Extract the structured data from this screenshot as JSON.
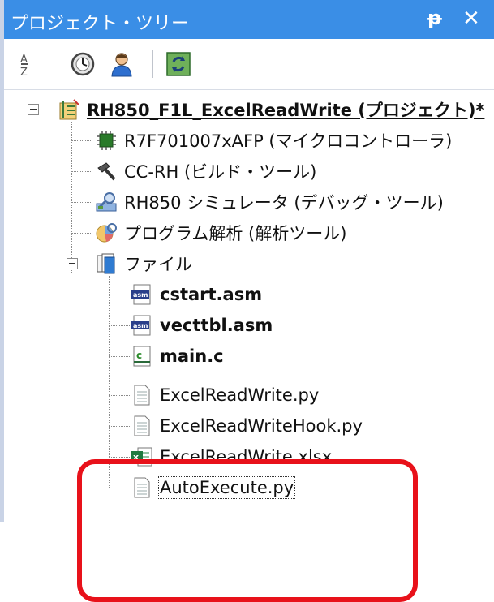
{
  "panel": {
    "title": "プロジェクト・ツリー",
    "pin_glyph": "ᵽ",
    "close_glyph": "✕",
    "toolbar": [
      {
        "name": "sort-icon",
        "glyph": "ア/Z"
      },
      {
        "name": "clock-icon"
      },
      {
        "name": "person-icon"
      },
      {
        "name": "refresh-icon"
      }
    ]
  },
  "tree": {
    "project": "RH850_F1L_ExcelReadWrite (プロジェクト)*",
    "nodes": [
      {
        "label": "R7F701007xAFP (マイクロコントローラ)",
        "icon": "chip-icon"
      },
      {
        "label": "CC-RH (ビルド・ツール)",
        "icon": "hammer-icon"
      },
      {
        "label": "RH850 シミュレータ (デバッグ・ツール)",
        "icon": "debugger-icon"
      },
      {
        "label": "プログラム解析 (解析ツール)",
        "icon": "analysis-icon"
      }
    ],
    "files_folder": "ファイル",
    "files": [
      {
        "label": "cstart.asm",
        "icon": "asm-file-icon",
        "bold": true
      },
      {
        "label": "vecttbl.asm",
        "icon": "asm-file-icon",
        "bold": true
      },
      {
        "label": "main.c",
        "icon": "c-file-icon",
        "bold": true
      },
      {
        "label": "ExcelReadWrite.py",
        "icon": "document-icon",
        "bold": false
      },
      {
        "label": "ExcelReadWriteHook.py",
        "icon": "document-icon",
        "bold": false
      },
      {
        "label": "ExcelReadWrite.xlsx",
        "icon": "excel-file-icon",
        "bold": false
      },
      {
        "label": "AutoExecute.py",
        "icon": "document-icon",
        "bold": false
      }
    ]
  },
  "colors": {
    "titlebar": "#3a8ee6",
    "highlight": "#e8111a"
  }
}
